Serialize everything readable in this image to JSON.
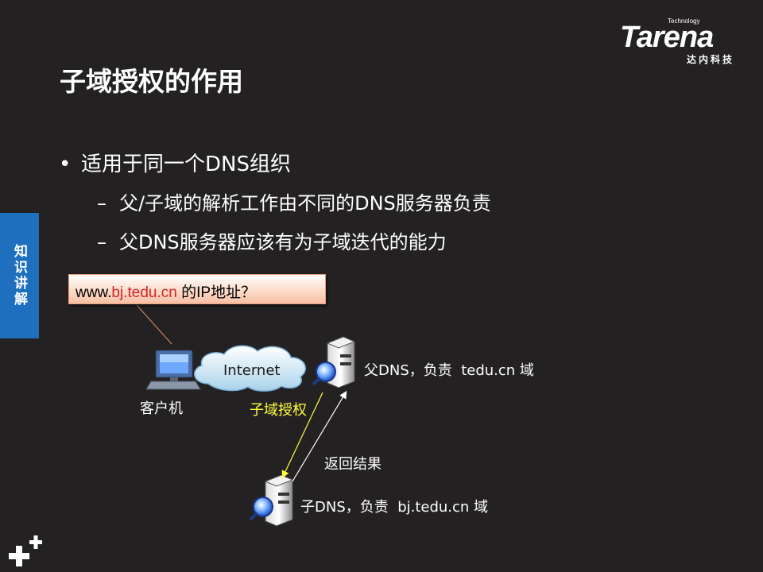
{
  "slide": {
    "title": "子域授权的作用",
    "side_tab": "知识讲解",
    "logo": {
      "brand": "Tarena",
      "tagline": "Technology",
      "cn": "达内科技"
    },
    "bullets": [
      {
        "text": "适用于同一个DNS组织",
        "level": 1,
        "marker": "•"
      },
      {
        "text": "父/子域的解析工作由不同的DNS服务器负责",
        "level": 2,
        "marker": "–"
      },
      {
        "text": "父DNS服务器应该有为子域迭代的能力",
        "level": 2,
        "marker": "–"
      }
    ]
  },
  "diagram": {
    "callout": {
      "prefix": "www.",
      "highlight": "bj.tedu.cn",
      "suffix": " 的IP地址？"
    },
    "cloud_label": "Internet",
    "client_label": "客户机",
    "delegation_label": "子域授权",
    "return_label": "返回结果",
    "parent_dns_label": "父DNS，负责  tedu.cn 域",
    "child_dns_label": "子DNS，负责  bj.tedu.cn 域",
    "colors": {
      "delegation_arrow": "#ffff3c",
      "return_arrow": "#ffffff",
      "callout_highlight": "#d2242a",
      "side_tab": "#1f6fbf"
    }
  }
}
